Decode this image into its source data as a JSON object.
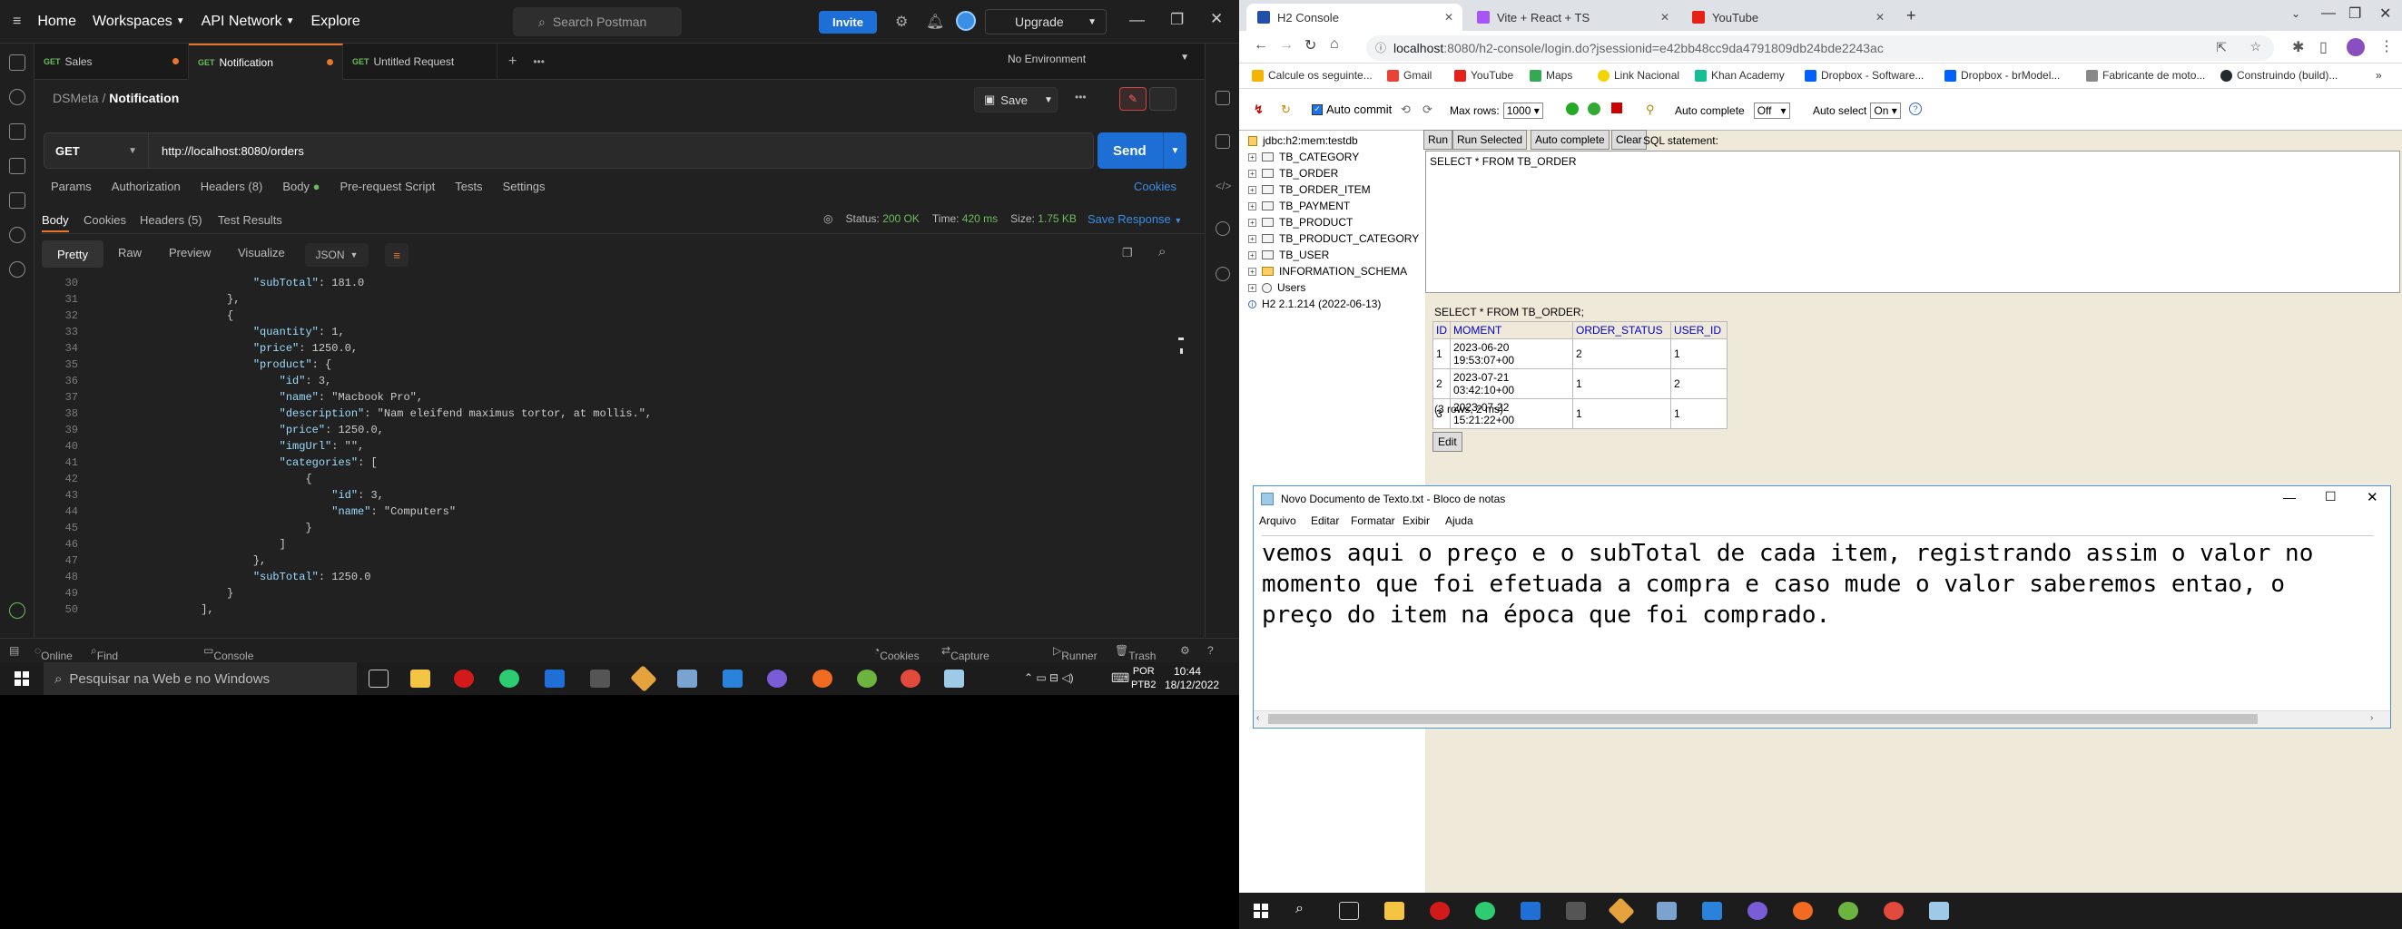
{
  "postman": {
    "nav": [
      "Home",
      "Workspaces",
      "API Network",
      "Explore"
    ],
    "search_placeholder": "Search Postman",
    "invite": "Invite",
    "upgrade": "Upgrade",
    "tabs": [
      {
        "method": "GET",
        "name": "Sales"
      },
      {
        "method": "GET",
        "name": "Notification"
      },
      {
        "method": "GET",
        "name": "Untitled Request"
      }
    ],
    "environment": "No Environment",
    "breadcrumb_parent": "DSMeta",
    "breadcrumb_sep": "/",
    "breadcrumb_current": "Notification",
    "save": "Save",
    "method": "GET",
    "url": "http://localhost:8080/orders",
    "send": "Send",
    "req_tabs": [
      "Params",
      "Authorization",
      "Headers (8)",
      "Body",
      "Pre-request Script",
      "Tests",
      "Settings"
    ],
    "cookies": "Cookies",
    "res_tabs": [
      "Body",
      "Cookies",
      "Headers (5)",
      "Test Results"
    ],
    "status_label": "Status:",
    "status_value": "200 OK",
    "time_label": "Time:",
    "time_value": "420 ms",
    "size_label": "Size:",
    "size_value": "1.75 KB",
    "save_response": "Save Response",
    "views": [
      "Pretty",
      "Raw",
      "Preview",
      "Visualize"
    ],
    "format": "JSON",
    "code_lines": [
      {
        "n": "30",
        "i": 6,
        "t": "\"subTotal\": 181.0"
      },
      {
        "n": "31",
        "i": 5,
        "t": "},"
      },
      {
        "n": "32",
        "i": 5,
        "t": "{"
      },
      {
        "n": "33",
        "i": 6,
        "t": "\"quantity\": 1,"
      },
      {
        "n": "34",
        "i": 6,
        "t": "\"price\": 1250.0,"
      },
      {
        "n": "35",
        "i": 6,
        "t": "\"product\": {"
      },
      {
        "n": "36",
        "i": 7,
        "t": "\"id\": 3,"
      },
      {
        "n": "37",
        "i": 7,
        "t": "\"name\": \"Macbook Pro\","
      },
      {
        "n": "38",
        "i": 7,
        "t": "\"description\": \"Nam eleifend maximus tortor, at mollis.\","
      },
      {
        "n": "39",
        "i": 7,
        "t": "\"price\": 1250.0,"
      },
      {
        "n": "40",
        "i": 7,
        "t": "\"imgUrl\": \"\","
      },
      {
        "n": "41",
        "i": 7,
        "t": "\"categories\": ["
      },
      {
        "n": "42",
        "i": 8,
        "t": "{"
      },
      {
        "n": "43",
        "i": 9,
        "t": "\"id\": 3,"
      },
      {
        "n": "44",
        "i": 9,
        "t": "\"name\": \"Computers\""
      },
      {
        "n": "45",
        "i": 8,
        "t": "}"
      },
      {
        "n": "46",
        "i": 7,
        "t": "]"
      },
      {
        "n": "47",
        "i": 6,
        "t": "},"
      },
      {
        "n": "48",
        "i": 6,
        "t": "\"subTotal\": 1250.0"
      },
      {
        "n": "49",
        "i": 5,
        "t": "}"
      },
      {
        "n": "50",
        "i": 4,
        "t": "],"
      }
    ],
    "footer": {
      "online": "Online",
      "find": "Find and Replace",
      "console": "Console",
      "cookies": "Cookies",
      "capture": "Capture requests",
      "runner": "Runner",
      "trash": "Trash"
    }
  },
  "taskbar_left": {
    "search_placeholder": "Pesquisar na Web e no Windows",
    "lang1": "POR",
    "lang2": "PTB2",
    "time": "10:44",
    "date": "18/12/2022"
  },
  "chrome": {
    "tabs": [
      "H2 Console",
      "Vite + React + TS",
      "YouTube"
    ],
    "url_host": "localhost",
    "url_rest": ":8080/h2-console/login.do?jsessionid=e42bb48cc9da4791809db24bde2243ac",
    "bookmarks": [
      "Calcule os seguinte...",
      "Gmail",
      "YouTube",
      "Maps",
      "Link Nacional",
      "Khan Academy",
      "Dropbox - Software...",
      "Dropbox - brModel...",
      "Fabricante de moto...",
      "Construindo (build)..."
    ]
  },
  "h2": {
    "auto_commit": "Auto commit",
    "max_rows_label": "Max rows:",
    "max_rows": "1000",
    "auto_complete_label": "Auto complete",
    "auto_complete": "Off",
    "auto_select_label": "Auto select",
    "auto_select": "On",
    "help": "?",
    "tree": [
      "jdbc:h2:mem:testdb",
      "TB_CATEGORY",
      "TB_ORDER",
      "TB_ORDER_ITEM",
      "TB_PAYMENT",
      "TB_PRODUCT",
      "TB_PRODUCT_CATEGORY",
      "TB_USER",
      "INFORMATION_SCHEMA",
      "Users",
      "H2 2.1.214 (2022-06-13)"
    ],
    "buttons": [
      "Run",
      "Run Selected",
      "Auto complete",
      "Clear"
    ],
    "sql_label": "SQL statement:",
    "sql": "SELECT * FROM TB_ORDER",
    "result_title": "SELECT * FROM TB_ORDER;",
    "columns": [
      "ID",
      "MOMENT",
      "ORDER_STATUS",
      "USER_ID"
    ],
    "rows": [
      [
        "1",
        "2023-06-20 19:53:07+00",
        "2",
        "1"
      ],
      [
        "2",
        "2023-07-21 03:42:10+00",
        "1",
        "2"
      ],
      [
        "3",
        "2023-07-22 15:21:22+00",
        "1",
        "1"
      ]
    ],
    "rows_info": "(3 rows, 2 ms)",
    "edit": "Edit"
  },
  "notepad": {
    "title": "Novo Documento de Texto.txt - Bloco de notas",
    "menu": [
      "Arquivo",
      "Editar",
      "Formatar",
      "Exibir",
      "Ajuda"
    ],
    "text": "vemos aqui o preço e o subTotal de cada item, registrando assim o valor no\nmomento que foi efetuada a compra e caso mude o valor saberemos entao, o\npreço do item na época que foi comprado."
  },
  "colors": {
    "postman_accent": "#e8762c",
    "send_blue": "#1d6fd6",
    "h2_bg": "#efe9da"
  }
}
